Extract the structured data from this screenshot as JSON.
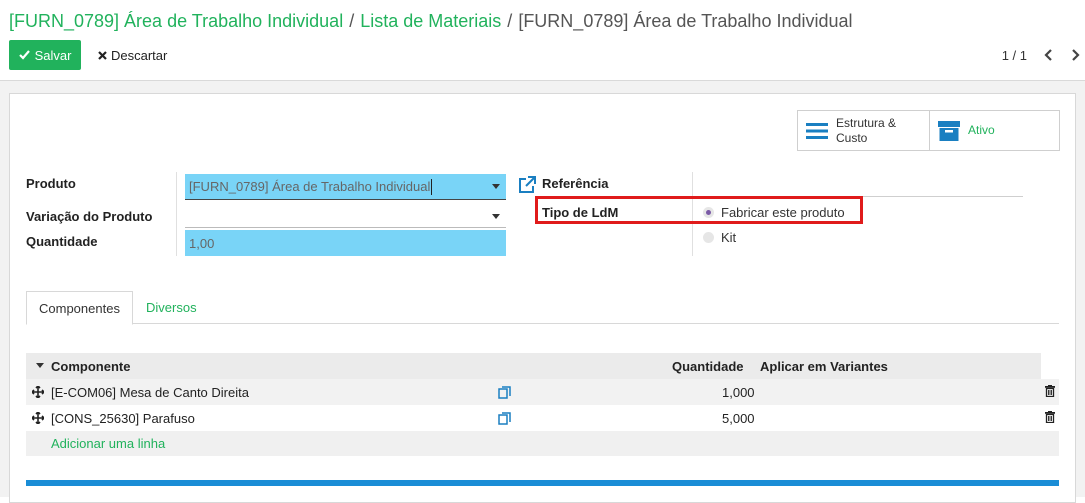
{
  "breadcrumb": {
    "items": [
      "[FURN_0789] Área de Trabalho Individual",
      "Lista de Materiais",
      "[FURN_0789] Área de Trabalho Individual"
    ],
    "separator": "/"
  },
  "toolbar": {
    "save_label": "Salvar",
    "discard_label": "Descartar"
  },
  "pager": {
    "value": "1 / 1"
  },
  "smart_buttons": {
    "structure_line1": "Estrutura &",
    "structure_line2": "Custo",
    "active_label": "Ativo"
  },
  "form": {
    "product_label": "Produto",
    "product_value": "[FURN_0789] Área de Trabalho Individual",
    "variant_label": "Variação do Produto",
    "variant_value": "",
    "quantity_label": "Quantidade",
    "quantity_value": "1,00",
    "reference_label": "Referência",
    "reference_value": "",
    "bom_type_label": "Tipo de LdM",
    "bom_type_options": [
      "Fabricar este produto",
      "Kit"
    ],
    "bom_type_selected": "Fabricar este produto"
  },
  "tabs": {
    "components": "Componentes",
    "misc": "Diversos"
  },
  "table": {
    "col_component": "Componente",
    "col_quantity": "Quantidade",
    "col_variants": "Aplicar em Variantes",
    "rows": [
      {
        "component": "[E-COM06] Mesa de Canto Direita",
        "quantity": "1,000"
      },
      {
        "component": "[CONS_25630] Parafuso",
        "quantity": "5,000"
      }
    ],
    "add_line": "Adicionar uma linha"
  },
  "colors": {
    "primary_green": "#21b25c",
    "highlight_blue": "#79d4f7",
    "annotation_red": "#e01b1b",
    "bar_blue": "#1a8dd6"
  },
  "icons": {
    "save": "check-icon",
    "discard": "x-icon",
    "pager_prev": "chevron-left-icon",
    "pager_next": "chevron-right-icon",
    "structure": "list-icon",
    "active": "archive-icon",
    "external": "external-link-icon",
    "drag": "drag-handle-icon",
    "copy": "copy-icon",
    "delete": "trash-icon"
  }
}
